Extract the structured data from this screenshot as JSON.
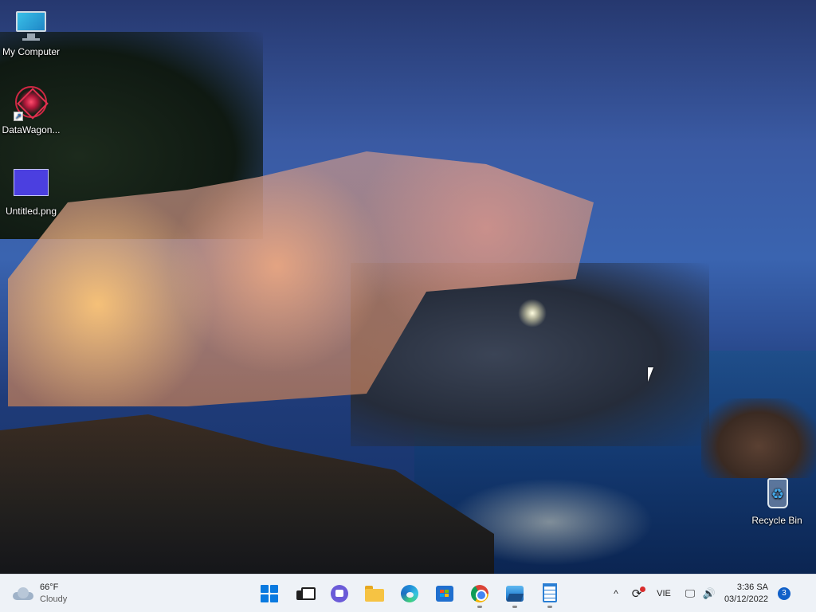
{
  "desktop": {
    "icons": [
      {
        "label": "My Computer"
      },
      {
        "label": "DataWagon..."
      },
      {
        "label": "Untitled.png"
      },
      {
        "label": "Recycle Bin"
      }
    ]
  },
  "taskbar": {
    "weather": {
      "temp": "66°F",
      "condition": "Cloudy"
    },
    "apps": [
      {
        "icon": "start-icon"
      },
      {
        "icon": "task-view-icon"
      },
      {
        "icon": "chat-icon"
      },
      {
        "icon": "file-explorer-icon"
      },
      {
        "icon": "edge-icon"
      },
      {
        "icon": "store-icon"
      },
      {
        "icon": "chrome-icon"
      },
      {
        "icon": "photos-icon"
      },
      {
        "icon": "notepad-icon"
      }
    ],
    "tray": {
      "chevron": "^",
      "sync": "⟳",
      "language": "VIE",
      "network": "🖵",
      "volume": "🔊",
      "time": "3:36 SA",
      "date": "03/12/2022",
      "notifications": "3"
    }
  }
}
